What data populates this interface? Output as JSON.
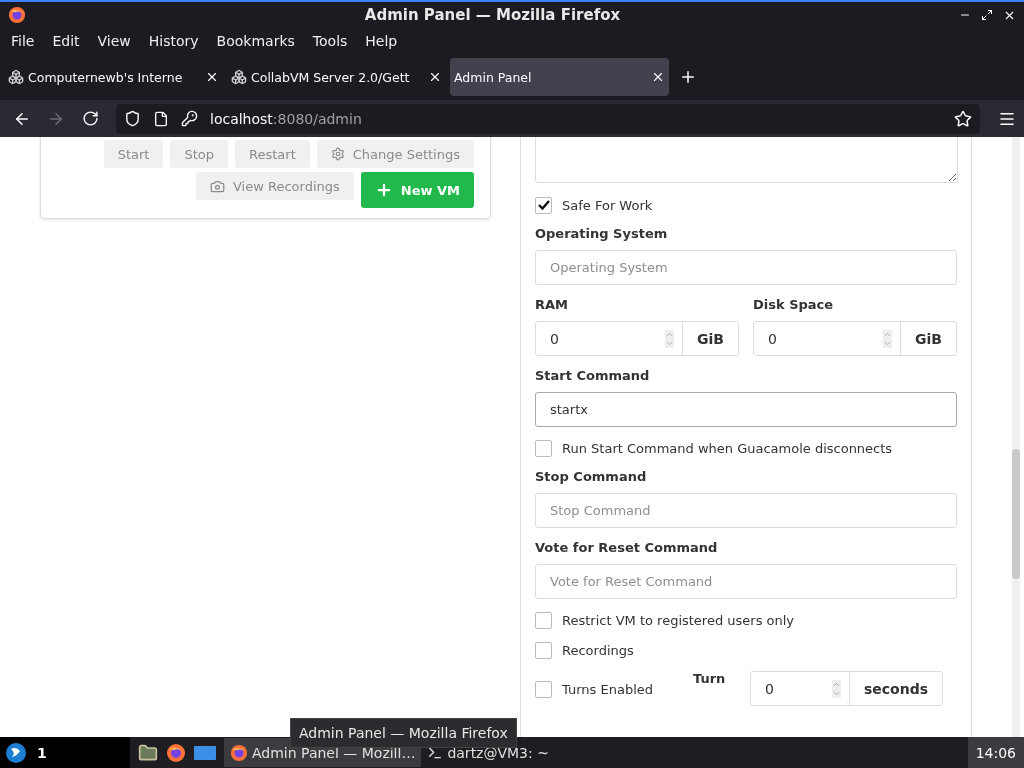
{
  "window": {
    "title": "Admin Panel — Mozilla Firefox"
  },
  "menu": [
    "File",
    "Edit",
    "View",
    "History",
    "Bookmarks",
    "Tools",
    "Help"
  ],
  "tabs": [
    {
      "label": "Computernewb's Interne",
      "selected": false,
      "favicon": true
    },
    {
      "label": "CollabVM Server 2.0/Gett",
      "selected": false,
      "favicon": true
    },
    {
      "label": "Admin Panel",
      "selected": true,
      "favicon": false
    }
  ],
  "nav": {
    "back_disabled": false,
    "forward_disabled": true,
    "url_host": "localhost",
    "url_path": ":8080/admin"
  },
  "vm_actions": [
    {
      "label": "Start",
      "kind": "plain",
      "disabled": true
    },
    {
      "label": "Stop",
      "kind": "plain",
      "disabled": true
    },
    {
      "label": "Restart",
      "kind": "plain",
      "disabled": true
    },
    {
      "label": "Change Settings",
      "kind": "settings",
      "disabled": true
    }
  ],
  "vm_actions_2": [
    {
      "label": "View Recordings",
      "kind": "recordings",
      "disabled": true
    },
    {
      "label": "New VM",
      "kind": "new",
      "disabled": false
    }
  ],
  "form": [
    {
      "kind": "textarea"
    },
    {
      "kind": "checkbox",
      "label": "Safe For Work",
      "checked": true
    },
    {
      "kind": "text",
      "label": "Operating System",
      "placeholder": "Operating System"
    },
    {
      "kind": "pair",
      "fields": [
        {
          "label": "RAM",
          "value": "0",
          "unit": "GiB"
        },
        {
          "label": "Disk Space",
          "value": "0",
          "unit": "GiB"
        }
      ]
    },
    {
      "kind": "text",
      "label": "Start Command",
      "value": "startx"
    },
    {
      "kind": "checkbox",
      "label": "Run Start Command when Guacamole disconnects",
      "checked": false
    },
    {
      "kind": "text",
      "label": "Stop Command",
      "placeholder": "Stop Command"
    },
    {
      "kind": "text",
      "label": "Vote for Reset Command",
      "placeholder": "Vote for Reset Command"
    },
    {
      "kind": "checkbox",
      "label": "Restrict VM to registered users only",
      "checked": false
    },
    {
      "kind": "checkbox",
      "label": "Recordings",
      "checked": false
    },
    {
      "kind": "turns",
      "label": "Turns Enabled",
      "checked": false,
      "field_label": "Turn",
      "value": "0",
      "unit": "seconds"
    }
  ],
  "taskbar": {
    "workspace": "1",
    "windows": [
      {
        "label": "Admin Panel — Mozill…",
        "kind": "firefox",
        "selected": true
      },
      {
        "label": "dartz@VM3: ~",
        "kind": "terminal",
        "selected": false
      }
    ],
    "clock": "14:06"
  },
  "tooltip": "Admin Panel — Mozilla Firefox"
}
